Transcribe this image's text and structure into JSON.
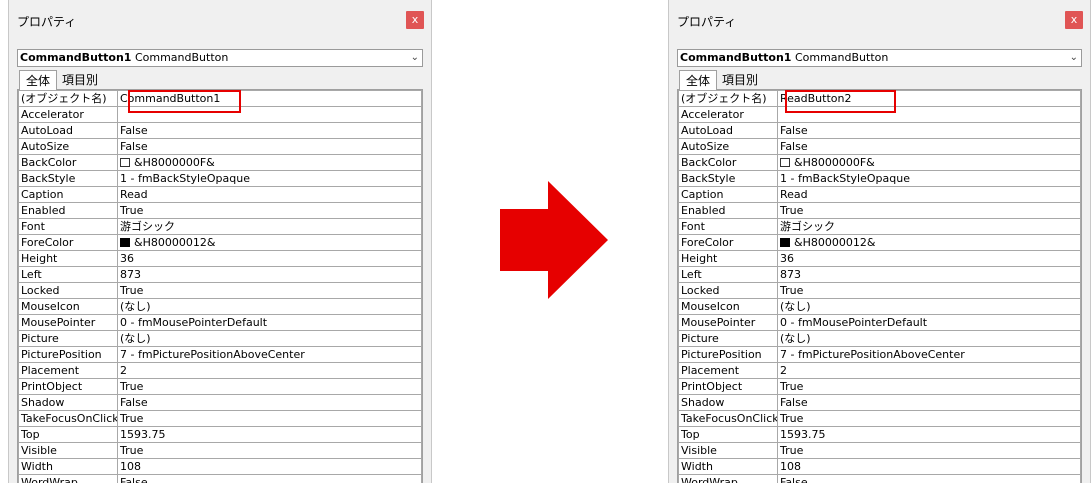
{
  "left_window": {
    "title": "プロパティ",
    "close_label": "x",
    "object_select": {
      "name": "CommandButton1",
      "type": "CommandButton"
    },
    "tabs": [
      {
        "label": "全体",
        "active": true
      },
      {
        "label": "項目別",
        "active": false
      }
    ],
    "properties": [
      {
        "name": "(オブジェクト名)",
        "value": "CommandButton1"
      },
      {
        "name": "Accelerator",
        "value": ""
      },
      {
        "name": "AutoLoad",
        "value": "False"
      },
      {
        "name": "AutoSize",
        "value": "False"
      },
      {
        "name": "BackColor",
        "value": "&H8000000F&",
        "swatch": "light"
      },
      {
        "name": "BackStyle",
        "value": "1 - fmBackStyleOpaque"
      },
      {
        "name": "Caption",
        "value": "Read"
      },
      {
        "name": "Enabled",
        "value": "True"
      },
      {
        "name": "Font",
        "value": "游ゴシック"
      },
      {
        "name": "ForeColor",
        "value": "&H80000012&",
        "swatch": "dark"
      },
      {
        "name": "Height",
        "value": "36"
      },
      {
        "name": "Left",
        "value": "873"
      },
      {
        "name": "Locked",
        "value": "True"
      },
      {
        "name": "MouseIcon",
        "value": "(なし)"
      },
      {
        "name": "MousePointer",
        "value": "0 - fmMousePointerDefault"
      },
      {
        "name": "Picture",
        "value": "(なし)"
      },
      {
        "name": "PicturePosition",
        "value": "7 - fmPicturePositionAboveCenter"
      },
      {
        "name": "Placement",
        "value": "2"
      },
      {
        "name": "PrintObject",
        "value": "True"
      },
      {
        "name": "Shadow",
        "value": "False"
      },
      {
        "name": "TakeFocusOnClick",
        "value": "True"
      },
      {
        "name": "Top",
        "value": "1593.75"
      },
      {
        "name": "Visible",
        "value": "True"
      },
      {
        "name": "Width",
        "value": "108"
      },
      {
        "name": "WordWrap",
        "value": "False"
      }
    ]
  },
  "right_window": {
    "title": "プロパティ",
    "close_label": "x",
    "object_select": {
      "name": "CommandButton1",
      "type": "CommandButton"
    },
    "tabs": [
      {
        "label": "全体",
        "active": true
      },
      {
        "label": "項目別",
        "active": false
      }
    ],
    "properties": [
      {
        "name": "(オブジェクト名)",
        "value": "ReadButton2"
      },
      {
        "name": "Accelerator",
        "value": ""
      },
      {
        "name": "AutoLoad",
        "value": "False"
      },
      {
        "name": "AutoSize",
        "value": "False"
      },
      {
        "name": "BackColor",
        "value": "&H8000000F&",
        "swatch": "light"
      },
      {
        "name": "BackStyle",
        "value": "1 - fmBackStyleOpaque"
      },
      {
        "name": "Caption",
        "value": "Read"
      },
      {
        "name": "Enabled",
        "value": "True"
      },
      {
        "name": "Font",
        "value": "游ゴシック"
      },
      {
        "name": "ForeColor",
        "value": "&H80000012&",
        "swatch": "dark"
      },
      {
        "name": "Height",
        "value": "36"
      },
      {
        "name": "Left",
        "value": "873"
      },
      {
        "name": "Locked",
        "value": "True"
      },
      {
        "name": "MouseIcon",
        "value": "(なし)"
      },
      {
        "name": "MousePointer",
        "value": "0 - fmMousePointerDefault"
      },
      {
        "name": "Picture",
        "value": "(なし)"
      },
      {
        "name": "PicturePosition",
        "value": "7 - fmPicturePositionAboveCenter"
      },
      {
        "name": "Placement",
        "value": "2"
      },
      {
        "name": "PrintObject",
        "value": "True"
      },
      {
        "name": "Shadow",
        "value": "False"
      },
      {
        "name": "TakeFocusOnClick",
        "value": "True"
      },
      {
        "name": "Top",
        "value": "1593.75"
      },
      {
        "name": "Visible",
        "value": "True"
      },
      {
        "name": "Width",
        "value": "108"
      },
      {
        "name": "WordWrap",
        "value": "False"
      }
    ]
  },
  "colors": {
    "arrow": "#e60000",
    "highlight": "#e60000",
    "close_button": "#e05555",
    "panel_bg": "#f0f0f0"
  },
  "icons": {
    "arrow": "right-arrow-icon",
    "close": "close-icon",
    "dropdown": "chevron-down-icon"
  }
}
